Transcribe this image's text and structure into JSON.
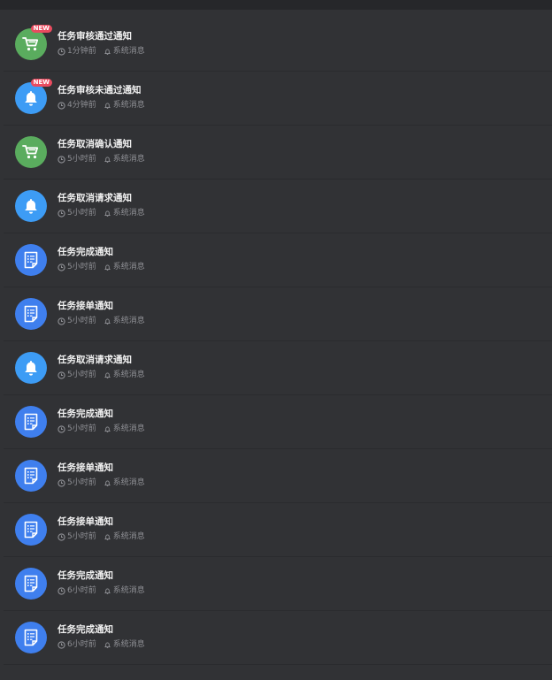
{
  "colors": {
    "green": "#5aac5e",
    "blue_bell": "#3d9cf5",
    "blue_doc": "#3f7fee",
    "badge": "#e94b5f"
  },
  "notifications": [
    {
      "title": "任务审核通过通知",
      "time": "1分钟前",
      "source": "系统消息",
      "icon": "cart-icon",
      "badge": "NEW"
    },
    {
      "title": "任务审核未通过通知",
      "time": "4分钟前",
      "source": "系统消息",
      "icon": "bell-icon",
      "badge": "NEW"
    },
    {
      "title": "任务取消确认通知",
      "time": "5小时前",
      "source": "系统消息",
      "icon": "cart-icon",
      "badge": ""
    },
    {
      "title": "任务取消请求通知",
      "time": "5小时前",
      "source": "系统消息",
      "icon": "bell-icon",
      "badge": ""
    },
    {
      "title": "任务完成通知",
      "time": "5小时前",
      "source": "系统消息",
      "icon": "document-icon",
      "badge": ""
    },
    {
      "title": "任务接单通知",
      "time": "5小时前",
      "source": "系统消息",
      "icon": "document-icon",
      "badge": ""
    },
    {
      "title": "任务取消请求通知",
      "time": "5小时前",
      "source": "系统消息",
      "icon": "bell-icon",
      "badge": ""
    },
    {
      "title": "任务完成通知",
      "time": "5小时前",
      "source": "系统消息",
      "icon": "document-icon",
      "badge": ""
    },
    {
      "title": "任务接单通知",
      "time": "5小时前",
      "source": "系统消息",
      "icon": "document-icon",
      "badge": ""
    },
    {
      "title": "任务接单通知",
      "time": "5小时前",
      "source": "系统消息",
      "icon": "document-icon",
      "badge": ""
    },
    {
      "title": "任务完成通知",
      "time": "6小时前",
      "source": "系统消息",
      "icon": "document-icon",
      "badge": ""
    },
    {
      "title": "任务完成通知",
      "time": "6小时前",
      "source": "系统消息",
      "icon": "document-icon",
      "badge": ""
    }
  ]
}
